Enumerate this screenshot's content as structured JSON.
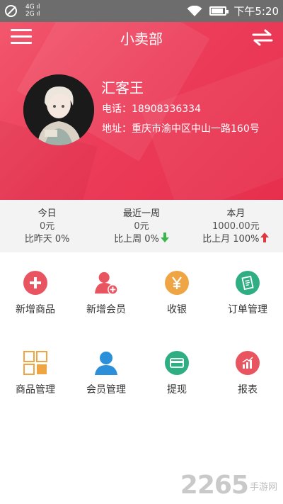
{
  "statusbar": {
    "net_top": "4G ıl",
    "net_bottom": "2G ıl",
    "time": "下午5:20"
  },
  "header": {
    "title": "小卖部",
    "name": "汇客王",
    "phone": "电话：18908336334",
    "address": "地址：重庆市渝中区中山一路160号"
  },
  "stats": [
    {
      "label": "今日",
      "value": "0元",
      "compare": "比昨天 0%",
      "trend": "none"
    },
    {
      "label": "最近一周",
      "value": "0元",
      "compare": "比上周 0%",
      "trend": "down"
    },
    {
      "label": "本月",
      "value": "1000.00元",
      "compare": "比上月 100%",
      "trend": "up"
    }
  ],
  "actions_row1": [
    {
      "label": "新增商品",
      "icon": "plus-icon",
      "color": "#e95461"
    },
    {
      "label": "新增会员",
      "icon": "add-member-icon",
      "color": "#e95461"
    },
    {
      "label": "收银",
      "icon": "yen-icon",
      "color": "#f0a545"
    },
    {
      "label": "订单管理",
      "icon": "order-list-icon",
      "color": "#2fae84"
    }
  ],
  "actions_row2": [
    {
      "label": "商品管理",
      "icon": "grid-icon",
      "color": "#f0a545"
    },
    {
      "label": "会员管理",
      "icon": "member-icon",
      "color": "#2b90d9"
    },
    {
      "label": "提现",
      "icon": "card-icon",
      "color": "#2fae84"
    },
    {
      "label": "报表",
      "icon": "report-icon",
      "color": "#e95461"
    }
  ],
  "watermark": {
    "number": "2265",
    "text": "手游网"
  },
  "colors": {
    "header": "#ec3d5a",
    "up": "#e0383e",
    "down": "#3cb54a"
  }
}
